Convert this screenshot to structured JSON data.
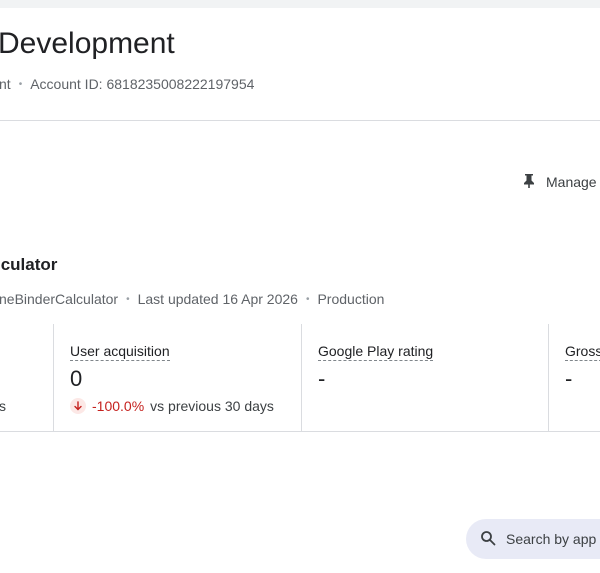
{
  "developer": {
    "title": "Development",
    "account_type": "nt",
    "account_id": "Account ID: 6818235008222197954"
  },
  "toolbar": {
    "manage_label": "Manage",
    "manage_icon": "pin-icon"
  },
  "app": {
    "title": "lculator",
    "package": "neBinderCalculator",
    "last_updated": "Last updated 16 Apr 2026",
    "track": "Production"
  },
  "metrics": {
    "first_tail": "s",
    "user_acquisition": {
      "label": "User acquisition",
      "value": "0",
      "change_pct": "-100.0%",
      "change_suffix": "vs previous 30 days",
      "trend_icon": "arrow-down-icon"
    },
    "rating": {
      "label": "Google Play rating",
      "value": "-"
    },
    "gross": {
      "label": "Gross",
      "value": "-"
    }
  },
  "search": {
    "placeholder": "Search by app",
    "icon": "search-icon"
  },
  "colors": {
    "negative": "#c5221f",
    "negative_bg": "#fce8e6",
    "search_bg": "#e8eaf6",
    "divider": "#dadce0"
  }
}
